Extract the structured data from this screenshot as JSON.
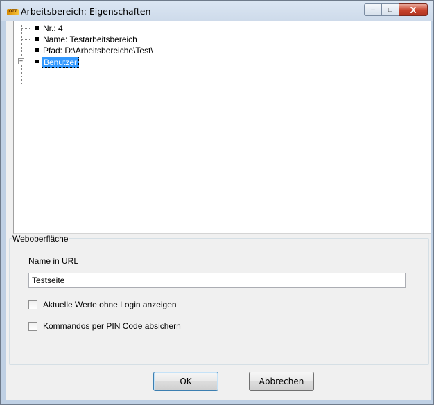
{
  "window": {
    "title": "Arbeitsbereich: Eigenschaften",
    "app_icon_text": "OTT",
    "controls": {
      "minimize": "‒",
      "maximize": "□",
      "close": "X"
    }
  },
  "tree": {
    "items": [
      {
        "label": "Nr.: 4"
      },
      {
        "label": "Name: Testarbeitsbereich"
      },
      {
        "label": "Pfad: D:\\Arbeitsbereiche\\Test\\"
      },
      {
        "label": "Benutzer",
        "selected": true,
        "expandable": true,
        "expander": "+"
      }
    ]
  },
  "web": {
    "group_label": "Weboberfläche",
    "name_label": "Name in URL",
    "name_value": "Testseite",
    "checkbox_current_values": "Aktuelle Werte ohne Login anzeigen",
    "checkbox_pin": "Kommandos per PIN Code absichern"
  },
  "buttons": {
    "ok": "OK",
    "cancel": "Abbrechen"
  },
  "colors": {
    "selection": "#3399ff",
    "title_gradient_top": "#dbe6f3",
    "close_button": "#c7432c"
  }
}
